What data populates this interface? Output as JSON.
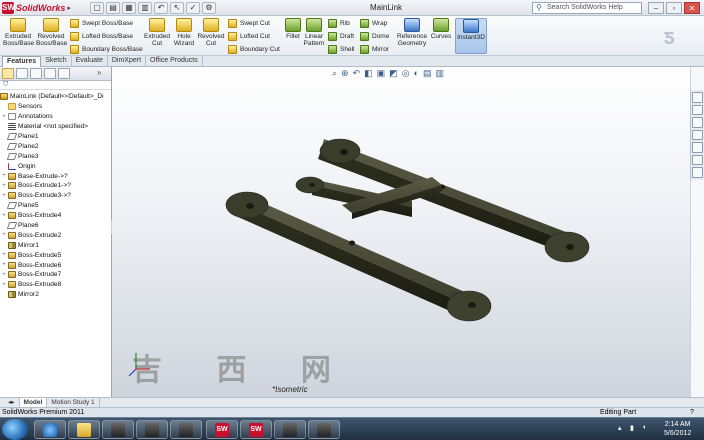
{
  "app": {
    "logo_text": "SolidWorks",
    "document_title": "MainLink",
    "help_placeholder": "Search SolidWorks Help"
  },
  "ribbon": {
    "extruded_boss": "Extruded Boss/Base",
    "revolved_boss": "Revolved Boss/Base",
    "swept_boss": "Swept Boss/Base",
    "lofted_boss": "Lofted Boss/Base",
    "boundary_boss": "Boundary Boss/Base",
    "extruded_cut": "Extruded Cut",
    "hole_wizard": "Hole Wizard",
    "revolved_cut": "Revolved Cut",
    "swept_cut": "Swept Cut",
    "lofted_cut": "Lofted Cut",
    "boundary_cut": "Boundary Cut",
    "fillet": "Fillet",
    "linear_pattern": "Linear Pattern",
    "rib": "Rib",
    "draft": "Draft",
    "shell": "Shell",
    "wrap": "Wrap",
    "dome": "Dome",
    "mirror": "Mirror",
    "reference_geometry": "Reference Geometry",
    "curves": "Curves",
    "instant3d": "Instant3D"
  },
  "tabs": [
    "Features",
    "Sketch",
    "Evaluate",
    "DimXpert",
    "Office Products"
  ],
  "tree": {
    "root": "MainLink  (Default<<Default>_Di",
    "items": [
      "Sensors",
      "Annotations",
      "Material <not specified>",
      "Plane1",
      "Plane2",
      "Plane3",
      "Origin",
      "Base-Extrude->?",
      "Boss-Extrude1->?",
      "Boss-Extrude3->?",
      "Plane5",
      "Boss-Extrude4",
      "Plane6",
      "Boss-Extrude2",
      "Mirror1",
      "Boss-Extrude5",
      "Boss-Extrude6",
      "Boss-Extrude7",
      "Boss-Extrude8",
      "Mirror2"
    ]
  },
  "graphics": {
    "view_name": "*Isometric",
    "watermark": "吉 西 网"
  },
  "model_tabs": [
    "Model",
    "Motion Study 1"
  ],
  "status": {
    "left": "SolidWorks Premium 2011",
    "right": "Editing Part"
  },
  "clock": {
    "time": "2:14 AM",
    "date": "5/6/2012"
  },
  "colors": {
    "part_body": "#3d3f2e",
    "accent": "#c8102e",
    "background_top": "#ffffff",
    "background_bottom": "#cdd3dc"
  }
}
